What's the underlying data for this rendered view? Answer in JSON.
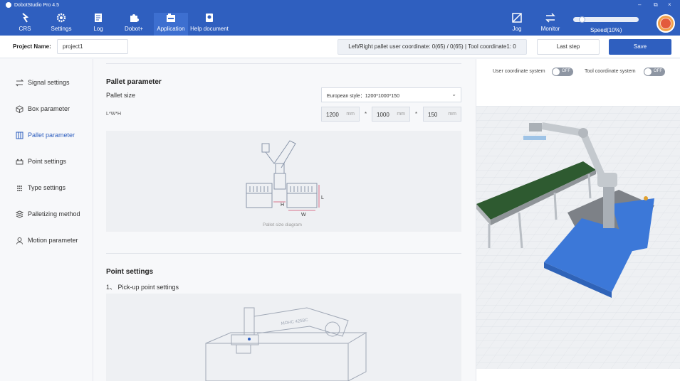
{
  "app": {
    "title": "DobotStudio Pro 4.5"
  },
  "window_controls": {
    "minimize": "–",
    "restore": "⧉",
    "close": "×"
  },
  "nav": {
    "left": [
      {
        "label": "CRS",
        "icon": "crs-icon"
      },
      {
        "label": "Settings",
        "icon": "gear-icon"
      },
      {
        "label": "Log",
        "icon": "log-icon"
      },
      {
        "label": "Dobot+",
        "icon": "puzzle-icon"
      },
      {
        "label": "Application",
        "icon": "application-icon"
      },
      {
        "label": "Help document",
        "icon": "help-document-icon"
      }
    ],
    "right": [
      {
        "label": "Jog",
        "icon": "jog-icon"
      },
      {
        "label": "Monitor",
        "icon": "monitor-icon"
      }
    ],
    "speed": {
      "label": "Speed(10%)",
      "value": 10
    }
  },
  "project": {
    "name_label": "Project Name:",
    "name_value": "project1",
    "coord_info": "Left/Right pallet user coordinate: 0(65) / 0(65) | Tool coordinate1: 0",
    "last_step": "Last step",
    "save": "Save"
  },
  "sidebar": {
    "items": [
      {
        "label": "Signal settings",
        "icon": "signal-icon"
      },
      {
        "label": "Box parameter",
        "icon": "box-icon"
      },
      {
        "label": "Pallet parameter",
        "icon": "pallet-icon"
      },
      {
        "label": "Point settings",
        "icon": "point-icon"
      },
      {
        "label": "Type settings",
        "icon": "type-icon"
      },
      {
        "label": "Palletizing method",
        "icon": "stack-icon"
      },
      {
        "label": "Motion parameter",
        "icon": "motion-icon"
      }
    ]
  },
  "pallet": {
    "title": "Pallet parameter",
    "size_label": "Pallet size",
    "size_value": "European style：1200*1000*150",
    "lwh_label": "L*W*H",
    "length": "1200",
    "width": "1000",
    "height": "150",
    "unit": "mm",
    "times": "*",
    "diagram_caption": "Pallet size diagram",
    "diag_h": "H",
    "diag_w": "W",
    "diag_l": "L"
  },
  "point": {
    "title": "Point settings",
    "sub": "1、 Pick-up point settings",
    "robot_text": "MOHC 425BC"
  },
  "view3d": {
    "user_coord_label": "User coordinate system",
    "tool_coord_label": "Tool coordinate system",
    "off": "OFF"
  },
  "colors": {
    "primary": "#2f5fbf",
    "belt": "#2e5a30",
    "pallet": "#3c78d8"
  }
}
